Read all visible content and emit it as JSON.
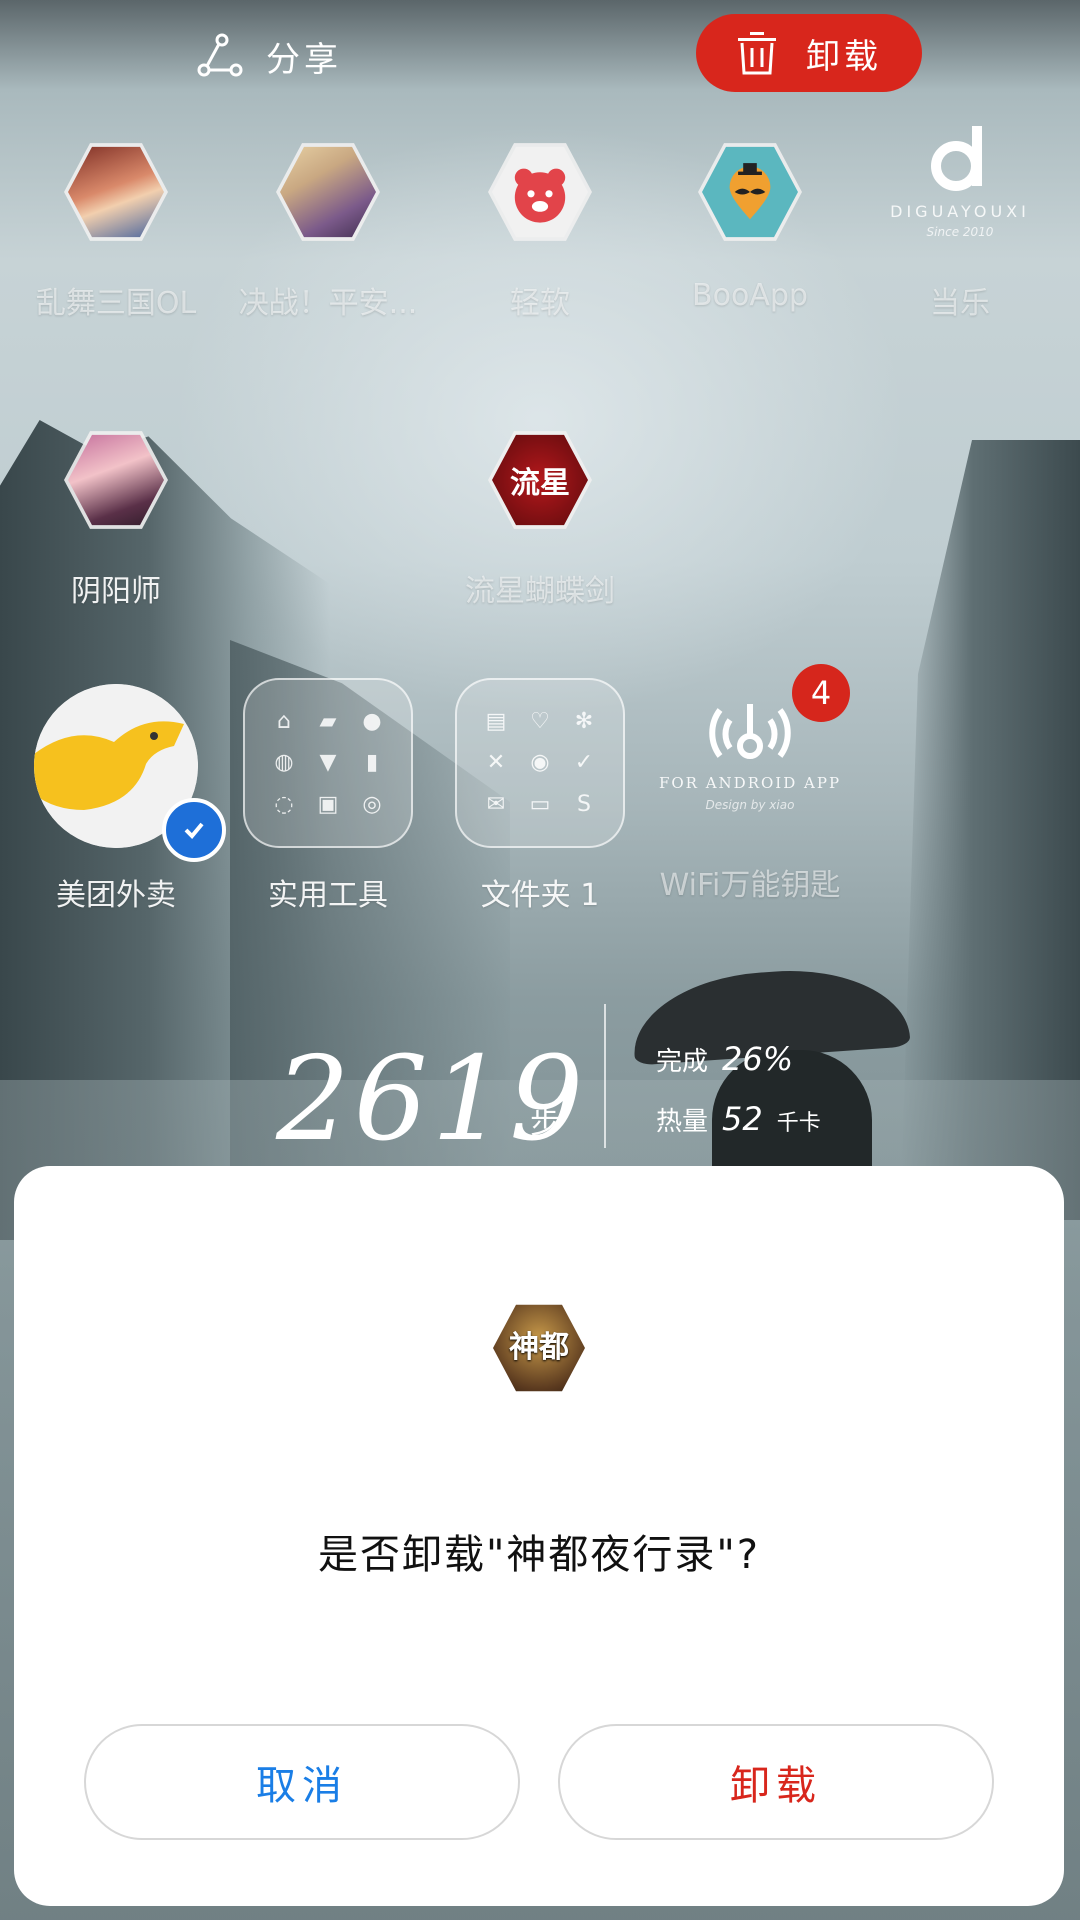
{
  "topbar": {
    "share_label": "分享",
    "uninstall_label": "卸载"
  },
  "apps_row1": [
    {
      "label": "乱舞三国OL",
      "icon": "game-avatar-woman-icon"
    },
    {
      "label": "决战！平安...",
      "icon": "game-avatar-blonde-icon"
    },
    {
      "label": "轻软",
      "icon": "red-bear-icon"
    },
    {
      "label": "BooApp",
      "icon": "mustache-pin-icon"
    },
    {
      "label": "当乐",
      "icon": "d-logo-icon",
      "logo_text": "DIGUAYOUXI",
      "logo_sub": "Since 2010"
    }
  ],
  "apps_row2": [
    {
      "label": "阴阳师",
      "icon": "onmyoji-icon"
    },
    {
      "label": "流星蝴蝶剑",
      "icon": "liuxing-icon",
      "icon_text": "流星"
    }
  ],
  "apps_row3": [
    {
      "label": "美团外卖",
      "icon": "kangaroo-icon"
    },
    {
      "label": "实用工具",
      "icon": "folder-icon"
    },
    {
      "label": "文件夹 1",
      "icon": "folder-icon"
    },
    {
      "label": "WiFi万能钥匙",
      "icon": "wifi-key-icon",
      "logo_text": "FOR ANDROID APP",
      "logo_sub": "Design by xiao",
      "badge": "4"
    }
  ],
  "steps": {
    "count": "2619",
    "unit": "步",
    "complete_label": "完成",
    "complete_value": "26%",
    "calorie_label": "热量",
    "calorie_value": "52",
    "calorie_unit": "千卡"
  },
  "dialog": {
    "app_icon_text": "神都",
    "message": "是否卸载\"神都夜行录\"?",
    "cancel_label": "取消",
    "confirm_label": "卸载"
  },
  "colors": {
    "accent_red": "#d8261c",
    "accent_blue": "#1a7ee6"
  }
}
